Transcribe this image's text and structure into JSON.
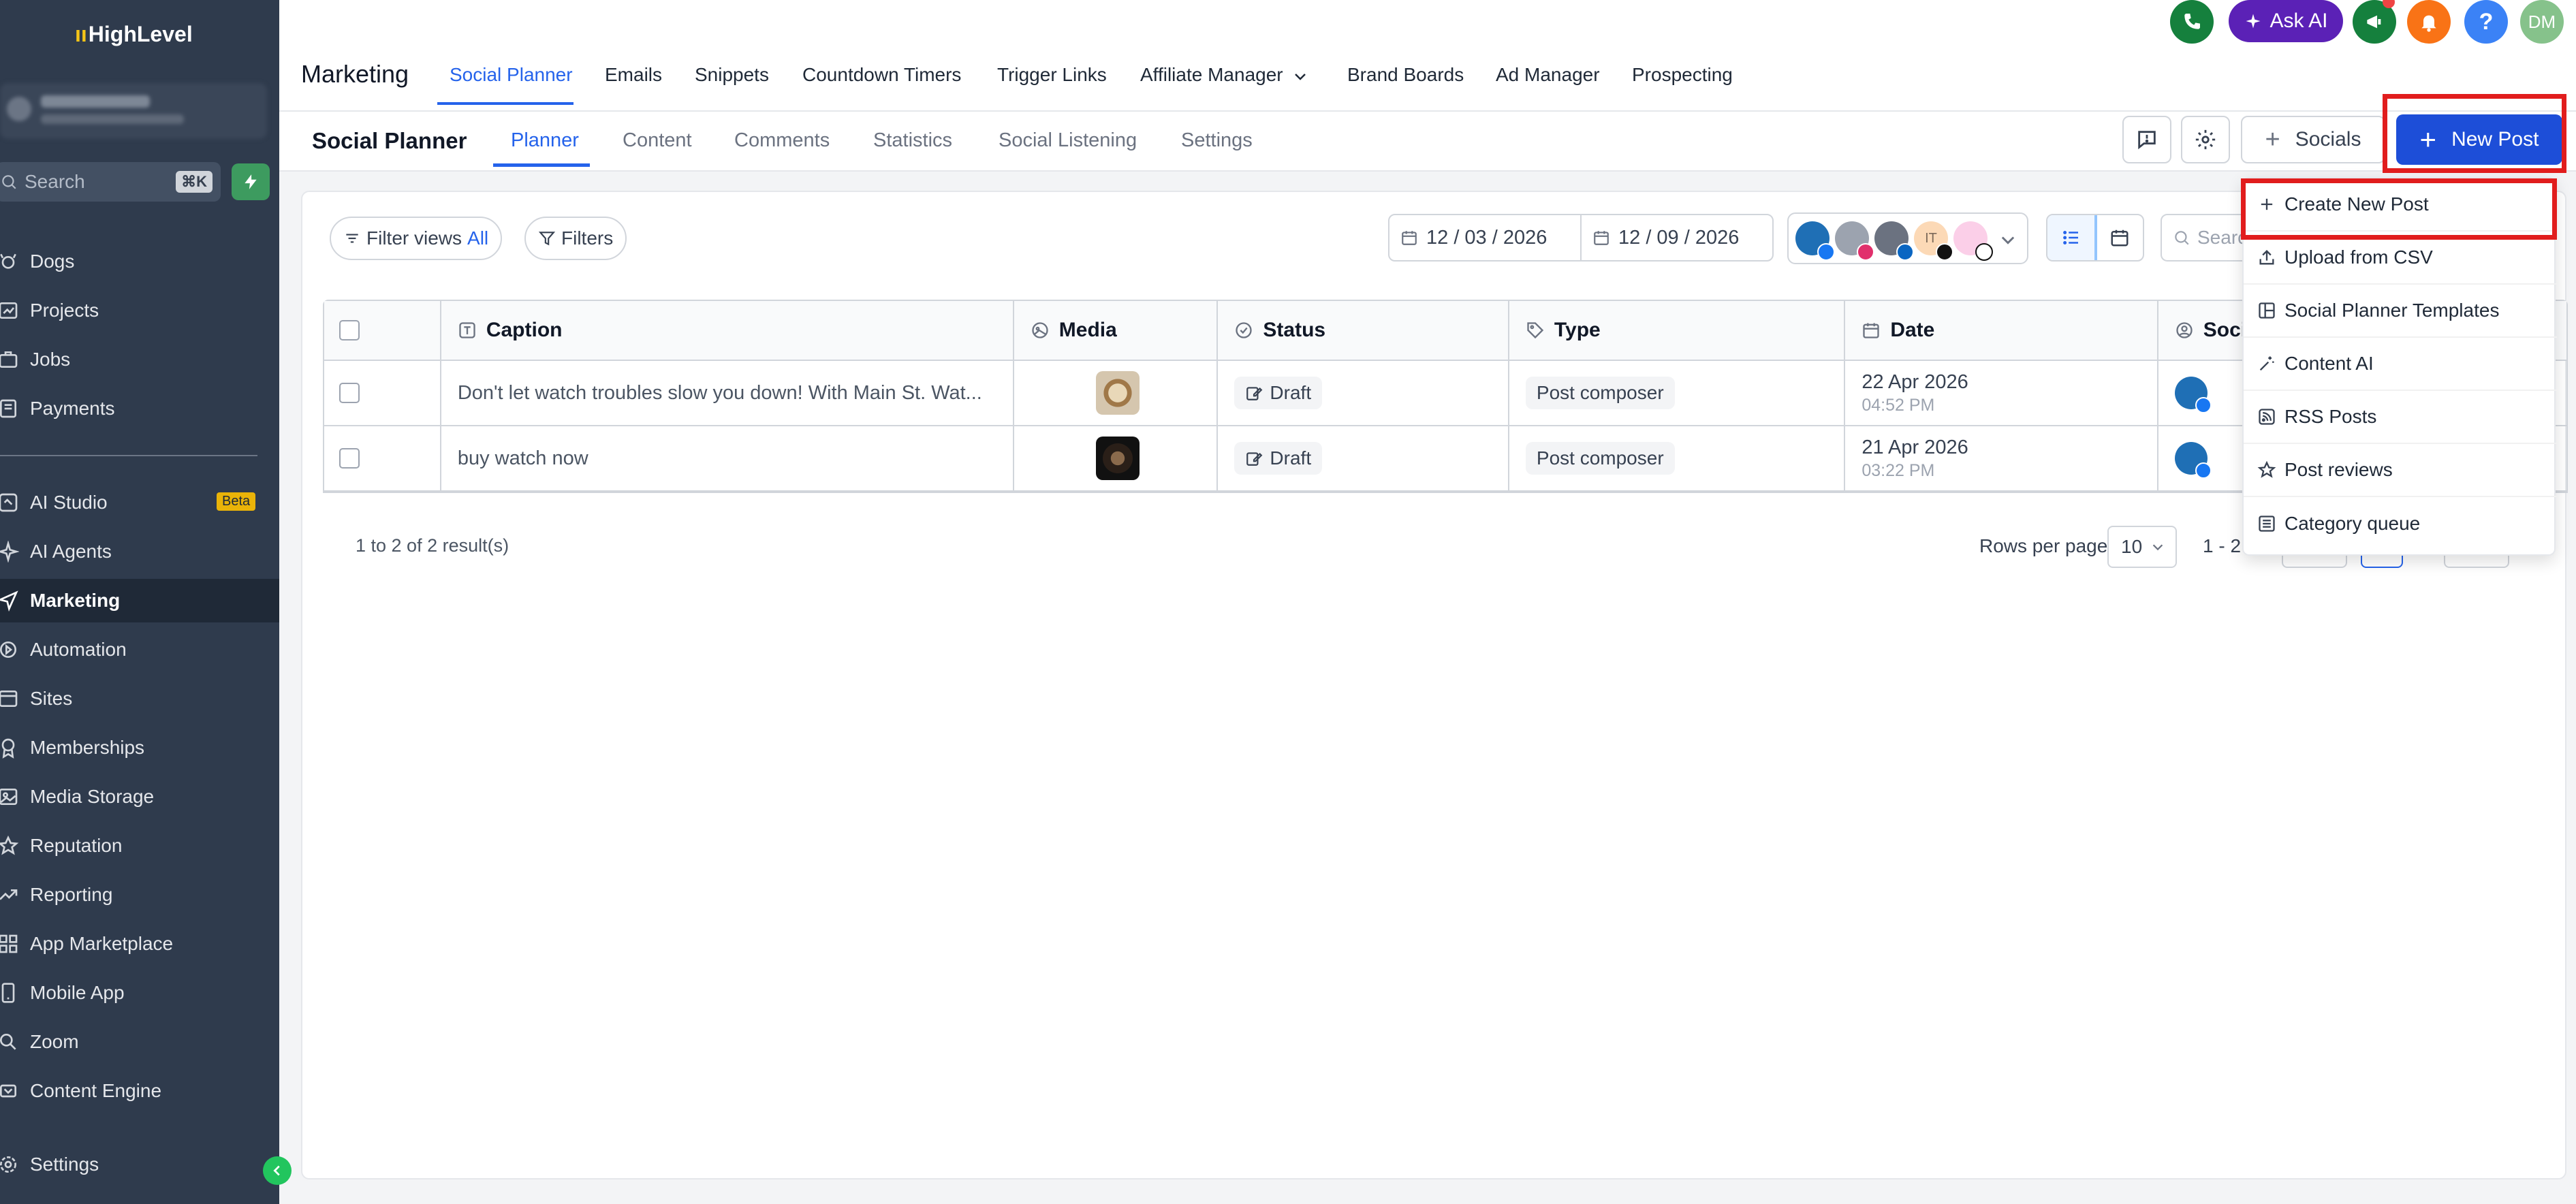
{
  "brand": {
    "logo_mark": "ıı",
    "logo_text": "HighLevel"
  },
  "sidebar": {
    "search_placeholder": "Search",
    "search_shortcut": "⌘K",
    "items": [
      {
        "label": "Dogs",
        "icon": "dog-icon"
      },
      {
        "label": "Projects",
        "icon": "projects-icon"
      },
      {
        "label": "Jobs",
        "icon": "briefcase-icon"
      },
      {
        "label": "Payments",
        "icon": "payments-icon"
      },
      {
        "label": "AI Studio",
        "icon": "ai-studio-icon",
        "badge": "Beta"
      },
      {
        "label": "AI Agents",
        "icon": "sparkle-icon"
      },
      {
        "label": "Marketing",
        "icon": "send-icon",
        "active": true
      },
      {
        "label": "Automation",
        "icon": "automation-icon"
      },
      {
        "label": "Sites",
        "icon": "globe-icon"
      },
      {
        "label": "Memberships",
        "icon": "award-icon"
      },
      {
        "label": "Media Storage",
        "icon": "image-icon"
      },
      {
        "label": "Reputation",
        "icon": "star-icon"
      },
      {
        "label": "Reporting",
        "icon": "trending-icon"
      },
      {
        "label": "App Marketplace",
        "icon": "grid-icon"
      },
      {
        "label": "Mobile App",
        "icon": "phone-icon"
      },
      {
        "label": "Zoom",
        "icon": "zoom-icon"
      },
      {
        "label": "Content Engine",
        "icon": "engine-icon"
      },
      {
        "label": "Settings",
        "icon": "gear-icon"
      }
    ]
  },
  "header": {
    "title": "Marketing",
    "tabs": [
      {
        "label": "Social Planner",
        "active": true
      },
      {
        "label": "Emails"
      },
      {
        "label": "Snippets"
      },
      {
        "label": "Countdown Timers"
      },
      {
        "label": "Trigger Links"
      },
      {
        "label": "Affiliate Manager"
      },
      {
        "label": "Brand Boards"
      },
      {
        "label": "Ad Manager"
      },
      {
        "label": "Prospecting"
      }
    ],
    "ask_ai": "Ask AI",
    "help": "?",
    "user_initials": "DM"
  },
  "subheader": {
    "title": "Social Planner",
    "tabs": [
      {
        "label": "Planner",
        "active": true
      },
      {
        "label": "Content"
      },
      {
        "label": "Comments"
      },
      {
        "label": "Statistics"
      },
      {
        "label": "Social Listening"
      },
      {
        "label": "Settings"
      }
    ],
    "socials_label": "Socials",
    "new_post_label": "New Post"
  },
  "toolbar": {
    "filter_views_label": "Filter views",
    "filter_views_value": "All",
    "filters_label": "Filters",
    "date_from": "12 / 03 / 2026",
    "date_to": "12 / 09 / 2026",
    "avatar_initials": "IT",
    "search_placeholder": "Search"
  },
  "table": {
    "columns": [
      "Caption",
      "Media",
      "Status",
      "Type",
      "Date",
      "Social"
    ],
    "rows": [
      {
        "caption": "Don't let watch troubles slow you down! With Main St. Wat...",
        "status": "Draft",
        "type": "Post composer",
        "date": "22 Apr 2026",
        "time": "04:52 PM"
      },
      {
        "caption": "buy watch now",
        "status": "Draft",
        "type": "Post composer",
        "date": "21 Apr 2026",
        "time": "03:22 PM"
      }
    ]
  },
  "pagination": {
    "result_text": "1 to 2 of 2 result(s)",
    "rows_per_page_label": "Rows per page",
    "rows_per_page_value": "10",
    "range_text": "1 - 2 of"
  },
  "dropdown": {
    "items": [
      {
        "label": "Create New Post",
        "icon": "plus-icon"
      },
      {
        "label": "Upload from CSV",
        "icon": "upload-icon"
      },
      {
        "label": "Social Planner Templates",
        "icon": "templates-icon"
      },
      {
        "label": "Content AI",
        "icon": "magic-icon"
      },
      {
        "label": "RSS Posts",
        "icon": "rss-icon"
      },
      {
        "label": "Post reviews",
        "icon": "star-icon"
      },
      {
        "label": "Category queue",
        "icon": "queue-icon"
      }
    ]
  },
  "colors": {
    "sidebar_bg": "#2f3b4d",
    "accent": "#2563eb",
    "primary_button": "#1d4ed8",
    "highlight_red": "#e11d1d",
    "ask_ai_bg": "#5b21b6"
  }
}
